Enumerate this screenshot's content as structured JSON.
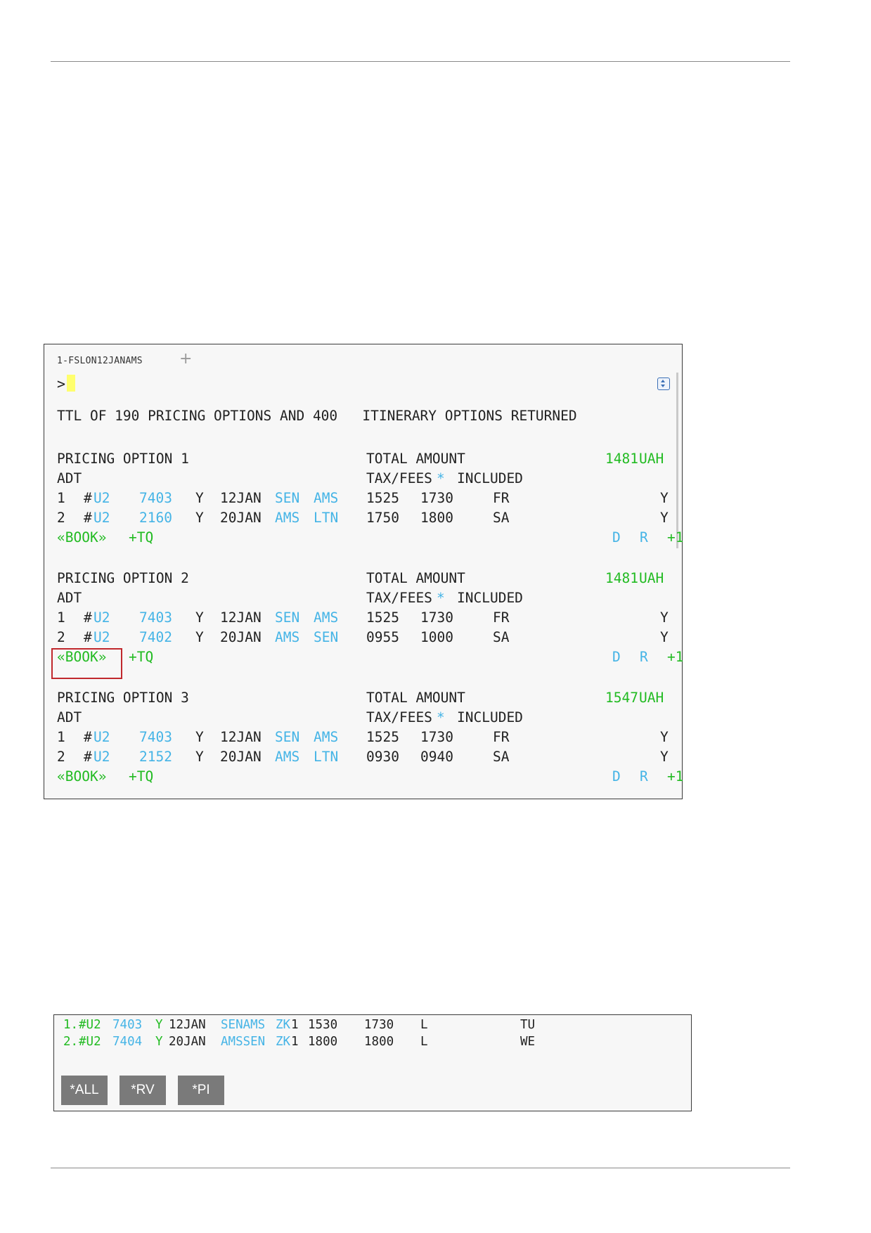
{
  "terminal": {
    "tab_label": "1-FSLON12JANAMS",
    "prompt": ">",
    "summary": "TTL OF 190 PRICING OPTIONS AND 400   ITINERARY OPTIONS RETURNED",
    "options": [
      {
        "title": "PRICING OPTION 1",
        "total_label": "TOTAL AMOUNT",
        "amount": "1481",
        "currency": "UAH",
        "pax": "ADT",
        "tax_label": "TAX/FEES",
        "tax_star": "*",
        "included": "INCLUDED",
        "segments": [
          {
            "n": "1",
            "hash": "#",
            "carrier": "U2",
            "flight": "7403",
            "cls": "Y",
            "date": "12JAN",
            "from": "SEN",
            "to": "AMS",
            "dep": "1525",
            "arr": "1730",
            "day": "FR",
            "flag": "Y"
          },
          {
            "n": "2",
            "hash": "#",
            "carrier": "U2",
            "flight": "2160",
            "cls": "Y",
            "date": "20JAN",
            "from": "AMS",
            "to": "LTN",
            "dep": "1750",
            "arr": "1800",
            "day": "SA",
            "flag": "Y"
          }
        ],
        "book": "«BOOK»",
        "tq": "+TQ",
        "d": "D",
        "r": "R",
        "plus1": "+1"
      },
      {
        "title": "PRICING OPTION 2",
        "total_label": "TOTAL AMOUNT",
        "amount": "1481",
        "currency": "UAH",
        "pax": "ADT",
        "tax_label": "TAX/FEES",
        "tax_star": "*",
        "included": "INCLUDED",
        "segments": [
          {
            "n": "1",
            "hash": "#",
            "carrier": "U2",
            "flight": "7403",
            "cls": "Y",
            "date": "12JAN",
            "from": "SEN",
            "to": "AMS",
            "dep": "1525",
            "arr": "1730",
            "day": "FR",
            "flag": "Y"
          },
          {
            "n": "2",
            "hash": "#",
            "carrier": "U2",
            "flight": "7402",
            "cls": "Y",
            "date": "20JAN",
            "from": "AMS",
            "to": "SEN",
            "dep": "0955",
            "arr": "1000",
            "day": "SA",
            "flag": "Y"
          }
        ],
        "book": "«BOOK»",
        "tq": "+TQ",
        "d": "D",
        "r": "R",
        "plus1": "+1"
      },
      {
        "title": "PRICING OPTION 3",
        "total_label": "TOTAL AMOUNT",
        "amount": "1547",
        "currency": "UAH",
        "pax": "ADT",
        "tax_label": "TAX/FEES",
        "tax_star": "*",
        "included": "INCLUDED",
        "segments": [
          {
            "n": "1",
            "hash": "#",
            "carrier": "U2",
            "flight": "7403",
            "cls": "Y",
            "date": "12JAN",
            "from": "SEN",
            "to": "AMS",
            "dep": "1525",
            "arr": "1730",
            "day": "FR",
            "flag": "Y"
          },
          {
            "n": "2",
            "hash": "#",
            "carrier": "U2",
            "flight": "2152",
            "cls": "Y",
            "date": "20JAN",
            "from": "AMS",
            "to": "LTN",
            "dep": "0930",
            "arr": "0940",
            "day": "SA",
            "flag": "Y"
          }
        ],
        "book": "«BOOK»",
        "tq": "+TQ",
        "d": "D",
        "r": "R",
        "plus1": "+1"
      }
    ]
  },
  "pnr": {
    "segments": [
      {
        "n": "1.",
        "carrier": "#U2",
        "flight": "7403",
        "cls": "Y",
        "date": "12JAN",
        "route": "SENAMS",
        "status": "ZK",
        "count": "1",
        "dep": "1530",
        "arr": "1730",
        "code": "L",
        "day": "TU"
      },
      {
        "n": "2.",
        "carrier": "#U2",
        "flight": "7404",
        "cls": "Y",
        "date": "20JAN",
        "route": "AMSSEN",
        "status": "ZK",
        "count": "1",
        "dep": "1800",
        "arr": "1800",
        "code": "L",
        "day": "WE"
      }
    ],
    "buttons": [
      "*ALL",
      "*RV",
      "*PI"
    ]
  },
  "colors": {
    "green": "#22bb22",
    "blue": "#45b4e6",
    "box_red": "#c0282d"
  }
}
